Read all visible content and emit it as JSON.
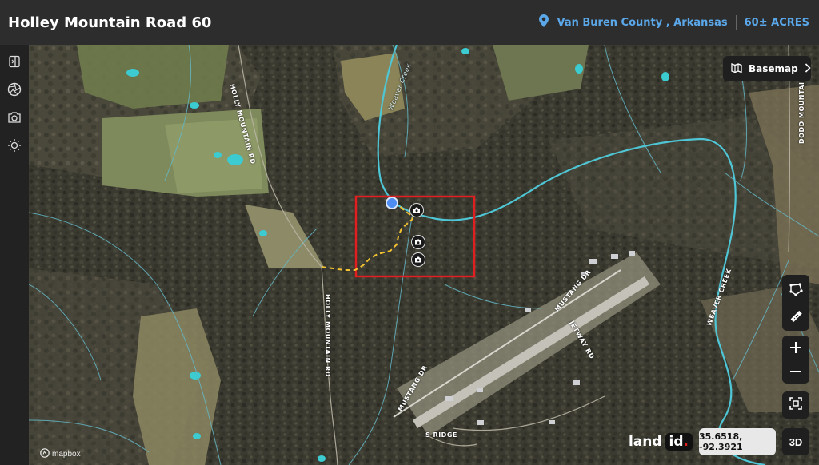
{
  "header": {
    "title": "Holley Mountain Road 60",
    "location": "Van Buren County , Arkansas",
    "acreage": "60± ACRES"
  },
  "toolbar": {
    "items": [
      "sidebar-toggle-icon",
      "aperture-icon",
      "camera-icon",
      "sun-icon"
    ]
  },
  "map": {
    "basemap_label": "Basemap",
    "road_labels": {
      "holly_mountain_rd_north": "HOLLY MOUNTAIN RD",
      "holly_mountain_rd_south": "HOLLY MOUNTAIN RD",
      "weaver_creek_north": "Weaver Creek",
      "weaver_creek_east": "WEAVER CREEK",
      "dodd_mountain_rd": "DODD MOUNTAIN RD",
      "mustang_dr_north": "MUSTANG DR",
      "mustang_dr_south": "MUSTANG DR",
      "jetway_rd": "JETWAY RD",
      "s_ridge": "S RIDGE"
    },
    "coordinates": "35.6518, -92.3921",
    "brand_land": "land",
    "brand_id": "id",
    "attribution": "mapbox",
    "view_3d_label": "3D",
    "photo_markers": 3,
    "colors": {
      "boundary": "#e02020",
      "trail": "#f2c230",
      "water": "#4fc6d6",
      "accent": "#5aa8ea"
    }
  }
}
